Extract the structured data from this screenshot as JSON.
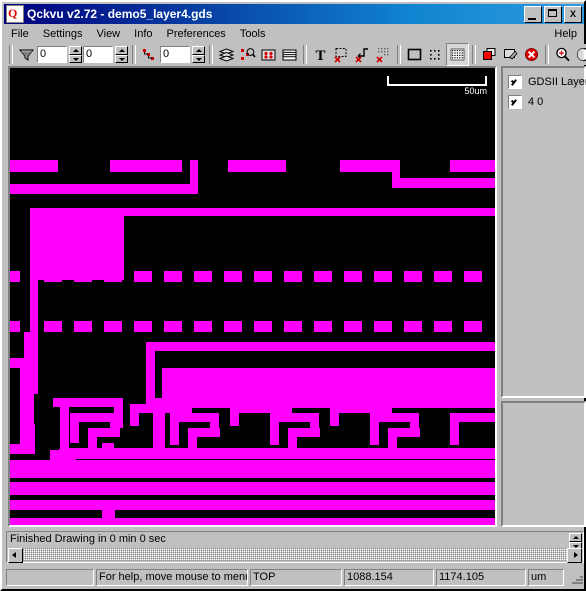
{
  "window": {
    "title": "Qckvu v2.72 - demo5_layer4.gds",
    "icon": "app-icon",
    "minimize_label": "_",
    "maximize_label": "□",
    "close_label": "X"
  },
  "menubar": {
    "items": [
      {
        "label": "File",
        "accel": "F"
      },
      {
        "label": "Settings",
        "accel": "S"
      },
      {
        "label": "View",
        "accel": "V"
      },
      {
        "label": "Info",
        "accel": "I"
      },
      {
        "label": "Preferences",
        "accel": "P"
      },
      {
        "label": "Tools",
        "accel": "T"
      },
      {
        "label": "Help",
        "accel": "H"
      }
    ]
  },
  "toolbar": {
    "filter_icon": "funnel-icon",
    "depth_value": "0",
    "level_value": "0",
    "hier_value": "0",
    "hier_icon": "hierarchy-icon",
    "buttons": [
      {
        "name": "layers-icon",
        "title": "Layers"
      },
      {
        "name": "inspect-layers-icon",
        "title": "Inspect"
      },
      {
        "name": "grid-dots-icon",
        "title": "Grid"
      },
      {
        "name": "lines-icon",
        "title": "Lines"
      },
      {
        "name": "text-icon",
        "title": "Text"
      },
      {
        "name": "box-no-icon",
        "title": "Hide Box"
      },
      {
        "name": "path-no-icon",
        "title": "Hide Path"
      },
      {
        "name": "fill-no-icon",
        "title": "Hide Fill"
      },
      {
        "name": "outline-icon",
        "title": "Outline"
      },
      {
        "name": "dotted-fill-icon",
        "title": "Dotted Fill"
      },
      {
        "name": "solid-fill-icon",
        "title": "Solid Fill"
      },
      {
        "name": "copy-layer-icon",
        "title": "Copy"
      },
      {
        "name": "edit-layer-icon",
        "title": "Edit"
      },
      {
        "name": "delete-icon",
        "title": "Delete"
      },
      {
        "name": "zoom-in-icon",
        "title": "Zoom In"
      },
      {
        "name": "zoom-moon-icon",
        "title": "Zoom"
      }
    ]
  },
  "canvas": {
    "background_color": "#000000",
    "shape_color": "#ff00ff",
    "scalebar_label": "50um"
  },
  "layer_panel": {
    "header_row": {
      "label": "GDSII Layer",
      "checked": true
    },
    "rows": [
      {
        "label": "4  0",
        "checked": true
      }
    ]
  },
  "log_pane": {
    "message": "Finished Drawing in 0 min 0 sec"
  },
  "statusbar": {
    "fields": [
      {
        "name": "progress-field",
        "value": ""
      },
      {
        "name": "hint-field",
        "value": "For help, move mouse to menu item"
      },
      {
        "name": "cell-field",
        "value": "TOP"
      },
      {
        "name": "x-coord-field",
        "value": "1088.154"
      },
      {
        "name": "y-coord-field",
        "value": "1174.105"
      },
      {
        "name": "units-field",
        "value": "um"
      }
    ]
  }
}
